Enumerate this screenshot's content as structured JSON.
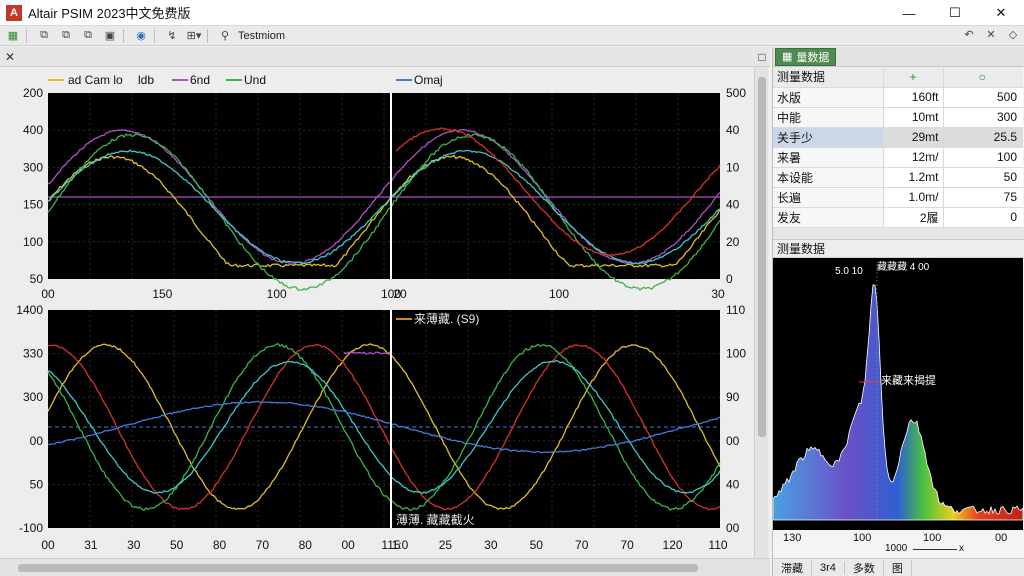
{
  "window": {
    "title": "Altair PSIM 2023中文免费版",
    "logo_letter": "A"
  },
  "toolbar": {
    "label": "Testmiom",
    "icons": [
      "grid-icon",
      "copy-icon",
      "copy-icon",
      "copy-icon",
      "wave-icon",
      "cursor-icon",
      "export-icon"
    ],
    "right_icons": [
      "undo-icon",
      "close-icon",
      "pin-icon"
    ]
  },
  "plotstrip": {
    "left_icon": "close-icon",
    "right_icon": "square-icon"
  },
  "colors": {
    "plot_bg": "#000000",
    "yellow": "#e0c020",
    "purple": "#b050c8",
    "green": "#39b54a",
    "blue": "#3d7dd8",
    "red": "#d6322a",
    "cyan": "#3cc8c8",
    "baseline": "#b050c8",
    "dash": "#3d7dd8"
  },
  "top_plot": {
    "legend_left": [
      "ad Cam lo",
      "ldb",
      "6nd",
      "Und"
    ],
    "legend_right": [
      "Omaj"
    ],
    "y_left_ticks": [
      "200",
      "400",
      "300",
      "150",
      "100",
      "50"
    ],
    "y_right_ticks": [
      "500",
      "40",
      "10",
      "40",
      "20",
      "0"
    ],
    "x_ticks_left": [
      "00",
      "150",
      "100",
      "100"
    ],
    "x_ticks_right": [
      "20",
      "100",
      "30"
    ]
  },
  "bottom_plot": {
    "annotation_top": "来薄藏. (S9)",
    "annotation_bottom": "薄薄. 藏藏截火",
    "y_left_ticks": [
      "1400",
      "330",
      "300",
      "00",
      "50",
      "-100"
    ],
    "y_right_ticks": [
      "110",
      "100",
      "90",
      "00",
      "40",
      "00"
    ],
    "x_ticks_left": [
      "00",
      "31",
      "30",
      "50",
      "80",
      "70",
      "80",
      "00",
      "115"
    ],
    "x_ticks_right": [
      "1:0",
      "25",
      "30",
      "50",
      "70",
      "70",
      "120",
      "110"
    ]
  },
  "measure_panel": {
    "tab_label": "量数据",
    "tab_icon": "chart-icon",
    "header": [
      "测量数据",
      "+",
      "○"
    ],
    "rows": [
      [
        "水版",
        "160ft",
        "500"
      ],
      [
        "中能",
        "10mt",
        "300"
      ],
      [
        "关手少",
        "29mt",
        "25.5"
      ],
      [
        "来暑",
        "12m/",
        "100"
      ],
      [
        "本设能",
        "1.2mt",
        "50"
      ],
      [
        "长遍",
        "1.0m/",
        "75"
      ],
      [
        "发友",
        "2履",
        "0"
      ]
    ],
    "selected_row": 2
  },
  "histogram": {
    "section_title": "测量数据",
    "label_top": "5.0 10",
    "label_top_right": "藏藏藏 4 00",
    "label_mid": "来藏来揭提",
    "x_ticks": [
      "130",
      "100",
      "100",
      "00"
    ],
    "x_label": "1000",
    "x_label_suffix": "x"
  },
  "status_bar": [
    "滞藏",
    "3r4",
    "多数",
    "图"
  ]
}
